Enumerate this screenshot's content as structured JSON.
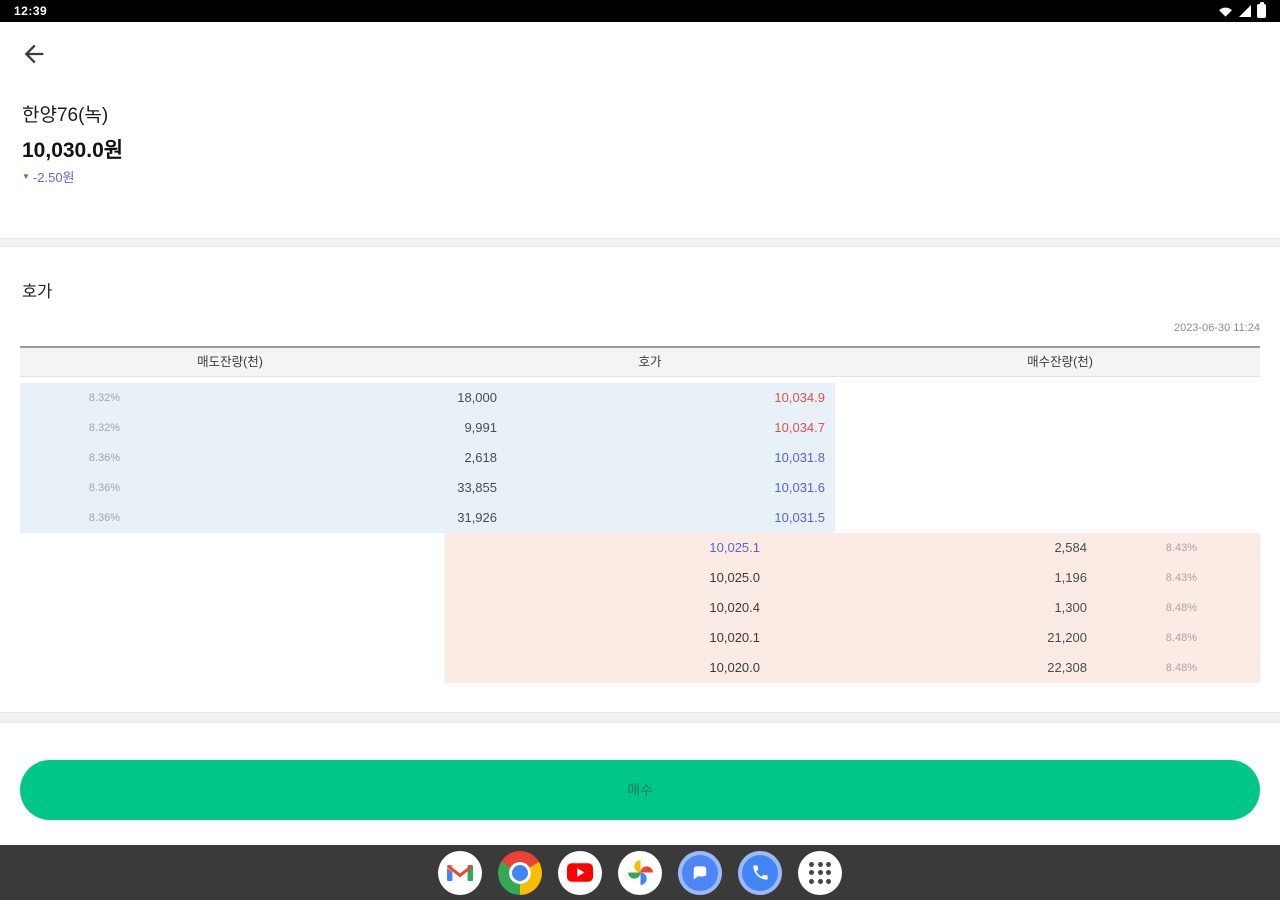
{
  "status_bar": {
    "time": "12:39"
  },
  "header": {
    "stock_name": "한양76(녹)",
    "price": "10,030.0원",
    "change_arrow": "▼",
    "change_text": "-2.50원"
  },
  "orderbook": {
    "section_title": "호가",
    "timestamp": "2023-06-30 11:24",
    "columns": {
      "ask_qty": "매도잔량(천)",
      "price": "호가",
      "bid_qty": "매수잔량(천)"
    },
    "asks": [
      {
        "yield": "8.32%",
        "qty": "18,000",
        "price": "10,034.9",
        "price_color": "red"
      },
      {
        "yield": "8.32%",
        "qty": "9,991",
        "price": "10,034.7",
        "price_color": "red"
      },
      {
        "yield": "8.36%",
        "qty": "2,618",
        "price": "10,031.8",
        "price_color": "blue"
      },
      {
        "yield": "8.36%",
        "qty": "33,855",
        "price": "10,031.6",
        "price_color": "blue"
      },
      {
        "yield": "8.36%",
        "qty": "31,926",
        "price": "10,031.5",
        "price_color": "blue"
      }
    ],
    "bids": [
      {
        "price": "10,025.1",
        "price_color": "blue",
        "qty": "2,584",
        "yield": "8.43%"
      },
      {
        "price": "10,025.0",
        "price_color": "dark",
        "qty": "1,196",
        "yield": "8.43%"
      },
      {
        "price": "10,020.4",
        "price_color": "dark",
        "qty": "1,300",
        "yield": "8.48%"
      },
      {
        "price": "10,020.1",
        "price_color": "dark",
        "qty": "21,200",
        "yield": "8.48%"
      },
      {
        "price": "10,020.0",
        "price_color": "dark",
        "qty": "22,308",
        "yield": "8.48%"
      }
    ]
  },
  "buy_button": {
    "label": "매수"
  },
  "dock": {
    "icons": [
      "gmail-icon",
      "chrome-icon",
      "youtube-icon",
      "photos-icon",
      "messages-icon",
      "phone-icon",
      "app-drawer-icon"
    ]
  },
  "colors": {
    "accent_green": "#00c788",
    "price_up_red": "#e0534d",
    "price_down_blue": "#5e60da",
    "change_blue": "#6463e2",
    "ask_bg": "#e7f1f7",
    "bid_bg": "#fcebe5"
  }
}
